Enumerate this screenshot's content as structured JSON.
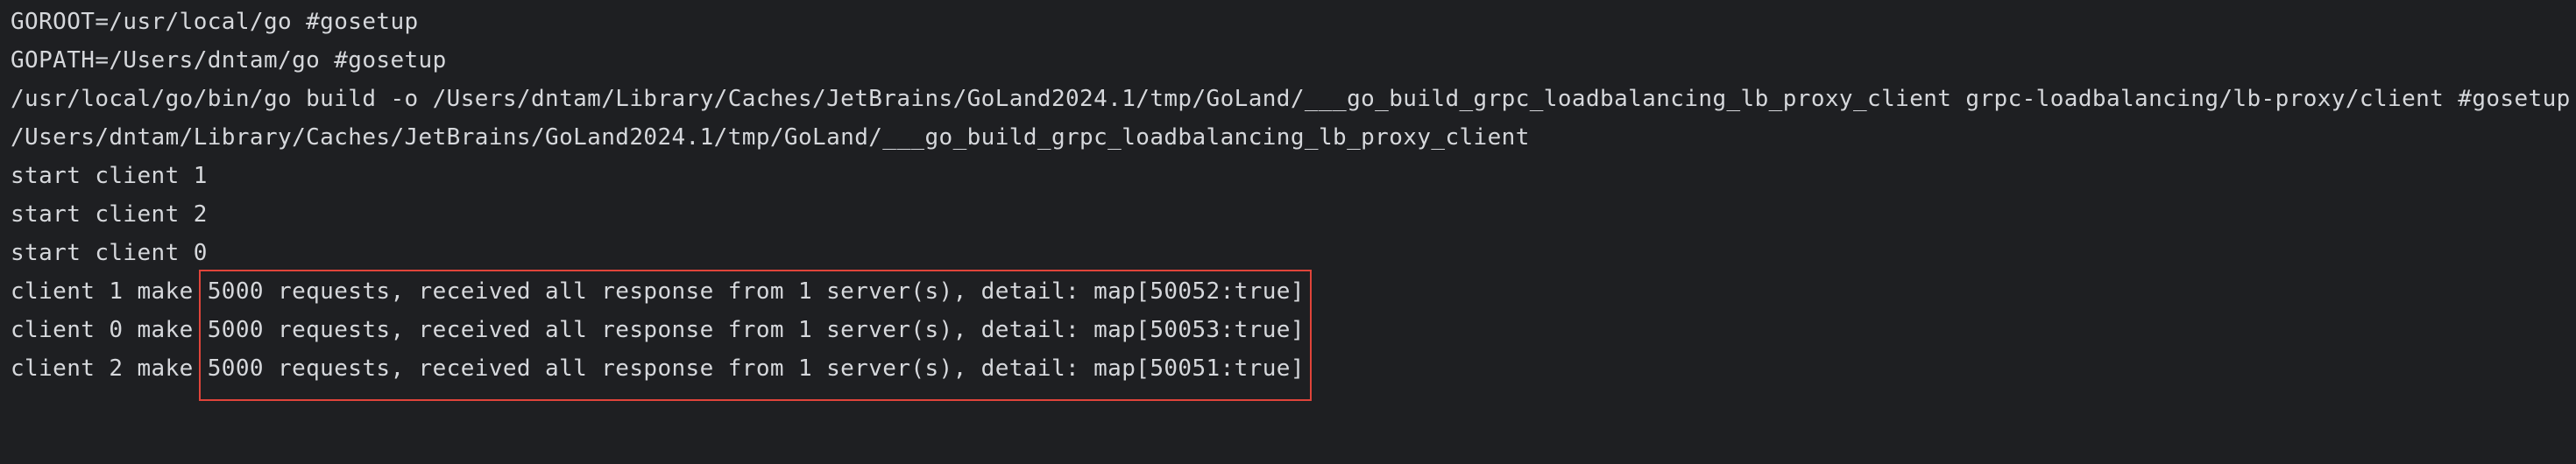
{
  "console": {
    "lines": [
      "GOROOT=/usr/local/go #gosetup",
      "GOPATH=/Users/dntam/go #gosetup",
      "/usr/local/go/bin/go build -o /Users/dntam/Library/Caches/JetBrains/GoLand2024.1/tmp/GoLand/___go_build_grpc_loadbalancing_lb_proxy_client grpc-loadbalancing/lb-proxy/client #gosetup",
      "/Users/dntam/Library/Caches/JetBrains/GoLand2024.1/tmp/GoLand/___go_build_grpc_loadbalancing_lb_proxy_client",
      "start client 1",
      "start client 2",
      "start client 0",
      "client 1 make 5000 requests, received all response from 1 server(s), detail: map[50052:true]",
      "client 0 make 5000 requests, received all response from 1 server(s), detail: map[50053:true]",
      "client 2 make 5000 requests, received all response from 1 server(s), detail: map[50051:true]"
    ],
    "highlight_color": "#e0443a",
    "background_color": "#1e1f22",
    "text_color": "#d6d8dc"
  }
}
